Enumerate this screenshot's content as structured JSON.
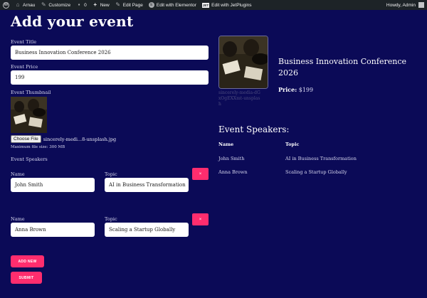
{
  "adminbar": {
    "site": "Arnau",
    "customize": "Customize",
    "comments": "0",
    "new": "New",
    "edit_page": "Edit Page",
    "elementor": "Edit with Elementor",
    "jet_badge": "JET",
    "jetplugins": "Edit with JetPlugins",
    "howdy": "Howdy, Admin"
  },
  "page_title": "Add your event",
  "form": {
    "title_label": "Event Title",
    "title_value": "Business Innovation Conference 2026",
    "price_label": "Event Price",
    "price_value": "199",
    "thumb_label": "Event Thumbnail",
    "choose_file": "Choose File",
    "file_name": "sincerely-medi...8-unsplash.jpg",
    "max_size": "Maximum file size: 300 MB",
    "speakers_label": "Event Speakers",
    "speakers": [
      {
        "name_label": "Name",
        "name": "John Smith",
        "topic_label": "Topic",
        "topic": "AI in Business Transformation",
        "remove": "×"
      },
      {
        "name_label": "Name",
        "name": "Anna Brown",
        "topic_label": "Topic",
        "topic": "Scaling a Startup Globally",
        "remove": "×"
      }
    ],
    "add_new": "ADD NEW",
    "submit": "SUBMIT"
  },
  "preview": {
    "caption": "sincerely-media-dGxOgEXXmt-unsplash",
    "title": "Business Innovation Conference 2026",
    "price_label": "Price:",
    "price_value": "$199",
    "speakers_heading": "Event Speakers:",
    "col_name": "Name",
    "col_topic": "Topic",
    "rows": [
      {
        "name": "John Smith",
        "topic": "AI in Business Transformation"
      },
      {
        "name": "Anna Brown",
        "topic": "Scaling a Startup Globally"
      }
    ]
  },
  "colors": {
    "background": "#0b0a57",
    "accent": "#ff2d6e",
    "adminbar": "#1d2327"
  }
}
